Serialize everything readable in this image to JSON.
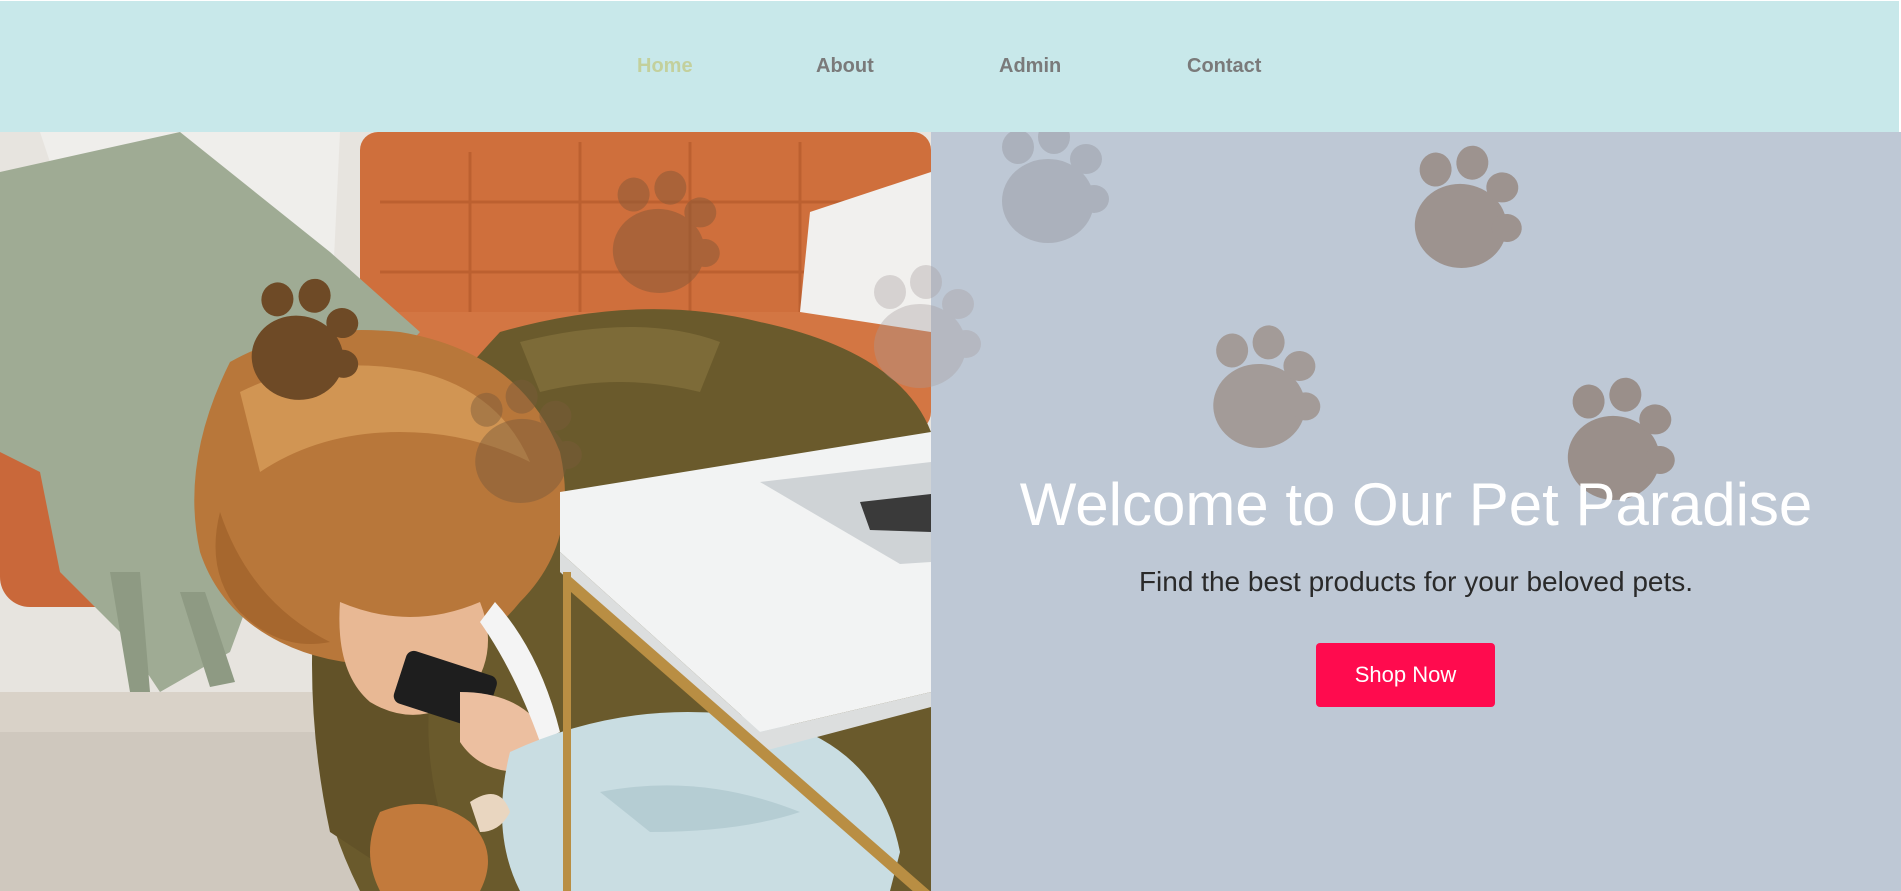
{
  "nav": {
    "items": [
      {
        "label": "Home",
        "active": true
      },
      {
        "label": "About",
        "active": false
      },
      {
        "label": "Admin",
        "active": false
      },
      {
        "label": "Contact",
        "active": false
      }
    ]
  },
  "hero": {
    "title": "Welcome to Our Pet Paradise",
    "subtitle": "Find the best products for your beloved pets.",
    "cta_label": "Shop Now",
    "photo_icon": "woman-with-puppy-photo",
    "decoration_icon": "paw-print-icon"
  },
  "colors": {
    "nav_background": "#c8e8ea",
    "nav_text": "#7a7a7a",
    "nav_active_text": "#c3d09c",
    "panel_background": "#bec8d5",
    "title_text": "#ffffff",
    "subtitle_text": "#2a2a2a",
    "cta_background": "#ff0b4e",
    "cta_text": "#ffffff",
    "paw_brown": "#6e4a26",
    "paw_gray": "#9a8f8a"
  }
}
